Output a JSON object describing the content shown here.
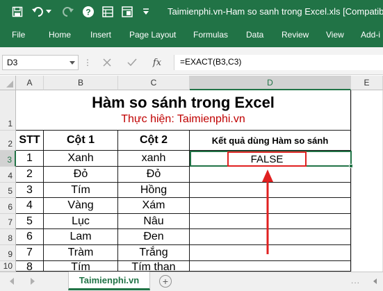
{
  "titlebar": {
    "title": "Taimienphi.vn-Ham so sanh trong Excel.xls  [Compatibility",
    "icons": [
      "save-icon",
      "undo-icon",
      "undo-dropdown-icon",
      "redo-icon",
      "help-icon",
      "form-icon",
      "customize-qat-icon"
    ]
  },
  "ribbon": {
    "tabs": [
      "File",
      "Home",
      "Insert",
      "Page Layout",
      "Formulas",
      "Data",
      "Review",
      "View",
      "Add-i"
    ]
  },
  "formula_bar": {
    "name_box": "D3",
    "fx_label": "fx",
    "formula": "=EXACT(B3,C3)"
  },
  "columns": [
    "A",
    "B",
    "C",
    "D",
    "E"
  ],
  "rows": [
    "1",
    "2",
    "3",
    "4",
    "5",
    "6",
    "7",
    "8",
    "9",
    "10"
  ],
  "sheet": {
    "title": "Hàm so sánh trong Excel",
    "subtitle": "Thực hiện: Taimienphi.vn",
    "headers": [
      "STT",
      "Cột 1",
      "Cột 2",
      "Kết quả dùng Hàm so sánh"
    ],
    "data": [
      [
        "1",
        "Xanh",
        "xanh",
        "FALSE"
      ],
      [
        "2",
        "Đỏ",
        "Đỏ",
        ""
      ],
      [
        "3",
        "Tím",
        "Hồng",
        ""
      ],
      [
        "4",
        "Vàng",
        "Xám",
        ""
      ],
      [
        "5",
        "Lục",
        "Nâu",
        ""
      ],
      [
        "6",
        "Lam",
        "Đen",
        ""
      ],
      [
        "7",
        "Tràm",
        "Trắng",
        ""
      ],
      [
        "8",
        "Tím",
        "Tím than",
        ""
      ]
    ]
  },
  "sheet_tabs": {
    "active": "Taimienphi.vn",
    "add_label": "+",
    "more": "..."
  },
  "colors": {
    "excel_green": "#217346",
    "subtitle_red": "#c00000",
    "highlight_red": "#e02020"
  }
}
